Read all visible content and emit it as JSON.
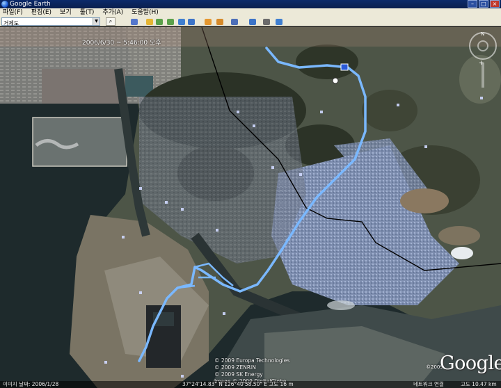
{
  "window": {
    "title": "Google Earth"
  },
  "menu": [
    {
      "label": "파일(F)"
    },
    {
      "label": "편집(E)"
    },
    {
      "label": "보기"
    },
    {
      "label": "툴(T)"
    },
    {
      "label": "추가(A)"
    },
    {
      "label": "도움말(H)"
    }
  ],
  "search": {
    "value": "거제도"
  },
  "toolbar": {
    "icons": [
      "sidebar-icon",
      "placemark-icon",
      "polygon-icon",
      "path-icon",
      "image-overlay-icon",
      "historical-imagery-icon",
      "sunlight-icon",
      "planet-icon",
      "ruler-icon",
      "email-icon",
      "print-icon",
      "view-in-maps-icon"
    ],
    "colors": [
      "#5577cc",
      "#e5b533",
      "#5aa04a",
      "#5aa04a",
      "#3f7fd0",
      "#3c74c8",
      "#e59830",
      "#d68a2a",
      "#4d6fb8",
      "#3c74c8",
      "#6b6b6b",
      "#3f7fd0"
    ]
  },
  "map": {
    "date_overlay": "2006/6/30 ~ 5:46:00 오후",
    "copyrights": [
      "© 2009 Europa Technologies",
      "© 2009 ZENRIN",
      "© 2009 SK Energy",
      "Image © 2009 DigitalGlobe"
    ],
    "logo_year": "©2009",
    "logo_text": "Google",
    "route_color": "#7ab8ff",
    "border_color": "#000000"
  },
  "status": {
    "image_date": "이미지 날짜: 2006/1/28",
    "coords": "37°24'14.83\" N   126°40'58.50\" E   고도   16 m",
    "streaming": "네트워크 연결",
    "eye_alt": "고도   10.47 km"
  }
}
